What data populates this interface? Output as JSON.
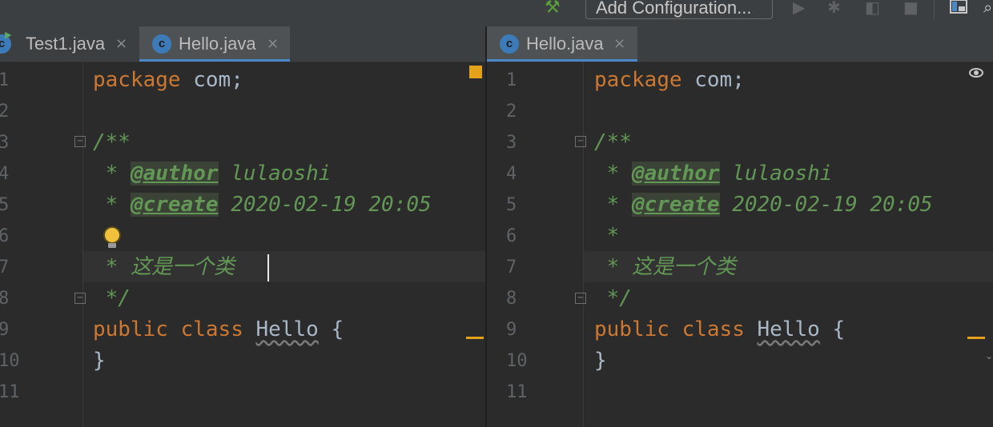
{
  "toolbar": {
    "add_configuration_label": "Add Configuration...",
    "icons": [
      "hammer-icon",
      "run-icon",
      "debug-icon",
      "coverage-icon",
      "stop-icon",
      "project-structure-icon",
      "search-icon"
    ]
  },
  "colors": {
    "keyword": "#cc7832",
    "doc_comment": "#629755",
    "plain_text": "#a9b7c6",
    "line_number": "#606366",
    "active_tab_underline": "#4a88c7",
    "warning": "#e3a21a",
    "editor_background": "#2b2b2b"
  },
  "left_pane": {
    "tabs": [
      {
        "label": "Test1.java",
        "close": "×",
        "active": false
      },
      {
        "label": "Hello.java",
        "close": "×",
        "active": true
      }
    ],
    "line_numbers": [
      "1",
      "2",
      "3",
      "4",
      "5",
      "6",
      "7",
      "8",
      "9",
      "10",
      "11"
    ],
    "code": {
      "l1_kw": "package",
      "l1_rest": " com;",
      "l3": "/**",
      "l4_star": " * ",
      "l4_tag": "@author",
      "l4_val": " lulaoshi",
      "l5_star": " * ",
      "l5_tag": "@create",
      "l5_val": " 2020-02-19 20:05",
      "l7": " * 这是一个类",
      "l8": " */",
      "l9_kw1": "public",
      "l9_kw2": "class",
      "l9_name": "Hello",
      "l9_brace": "{",
      "l10": "}"
    }
  },
  "right_pane": {
    "tabs": [
      {
        "label": "Hello.java",
        "close": "×",
        "active": true
      }
    ],
    "line_numbers": [
      "1",
      "2",
      "3",
      "4",
      "5",
      "6",
      "7",
      "8",
      "9",
      "10",
      "11"
    ],
    "code": {
      "l1_kw": "package",
      "l1_rest": " com;",
      "l3": "/**",
      "l4_star": " * ",
      "l4_tag": "@author",
      "l4_val": " lulaoshi",
      "l5_star": " * ",
      "l5_tag": "@create",
      "l5_val": " 2020-02-19 20:05",
      "l6": " *",
      "l7": " * 这是一个类",
      "l8": " */",
      "l9_kw1": "public",
      "l9_kw2": "class",
      "l9_name": "Hello",
      "l9_brace": "{",
      "l10": "}"
    }
  }
}
